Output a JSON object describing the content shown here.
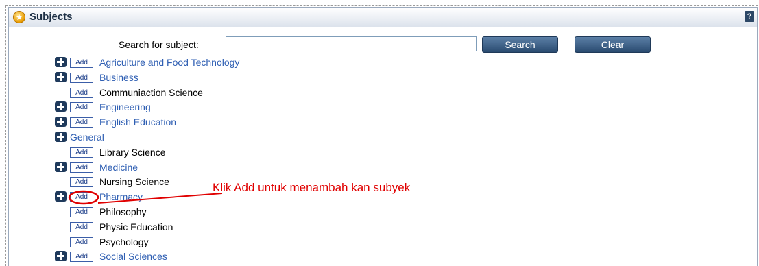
{
  "panel": {
    "title": "Subjects",
    "help_icon_label": "?"
  },
  "search": {
    "label": "Search for subject:",
    "input_value": "",
    "search_button": "Search",
    "clear_button": "Clear"
  },
  "subjects": [
    {
      "name": "Agriculture and Food Technology",
      "expandable": true,
      "add": "Add",
      "style": "link"
    },
    {
      "name": "Business",
      "expandable": true,
      "add": "Add",
      "style": "link"
    },
    {
      "name": "Communiaction Science",
      "expandable": false,
      "add": "Add",
      "style": "plain"
    },
    {
      "name": "Engineering",
      "expandable": true,
      "add": "Add",
      "style": "link"
    },
    {
      "name": "English Education",
      "expandable": true,
      "add": "Add",
      "style": "link"
    },
    {
      "name": "General",
      "expandable": true,
      "add": "",
      "style": "link"
    },
    {
      "name": "Library Science",
      "expandable": false,
      "add": "Add",
      "style": "plain"
    },
    {
      "name": "Medicine",
      "expandable": true,
      "add": "Add",
      "style": "link"
    },
    {
      "name": "Nursing Science",
      "expandable": false,
      "add": "Add",
      "style": "plain"
    },
    {
      "name": "Pharmacy",
      "expandable": true,
      "add": "Add",
      "style": "link"
    },
    {
      "name": "Philosophy",
      "expandable": false,
      "add": "Add",
      "style": "plain"
    },
    {
      "name": "Physic Education",
      "expandable": false,
      "add": "Add",
      "style": "plain"
    },
    {
      "name": "Psychology",
      "expandable": false,
      "add": "Add",
      "style": "plain"
    },
    {
      "name": "Social Sciences",
      "expandable": true,
      "add": "Add",
      "style": "link"
    }
  ],
  "annotation": {
    "text": "Klik Add untuk menambah kan subyek",
    "color": "#e00000"
  },
  "colors": {
    "link": "#2f5fb3",
    "button": "#2a4b70",
    "header_title": "#1d2f44"
  }
}
